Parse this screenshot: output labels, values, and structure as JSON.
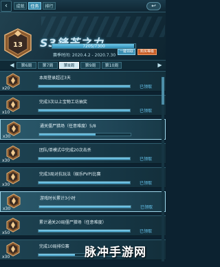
{
  "topbar": {
    "back_icon": "back-arrow-icon",
    "tabs": [
      {
        "label": "成就",
        "active": false
      },
      {
        "label": "任务",
        "active": true
      },
      {
        "label": "排行",
        "active": false
      }
    ],
    "close_icon": "close-icon",
    "close_glyph": "↩"
  },
  "season": {
    "title": "S3锋芒之力",
    "progress_text": "7205/7300",
    "progress_ratio": 0.987,
    "time_label": "赛季时间: 2020.4.2 - 2020.7.30",
    "upgrade_label": "一键领取",
    "buy_label": "购买等级",
    "badge_level": "13"
  },
  "weeks": {
    "left_arrow": "◀",
    "right_arrow": "▶",
    "tabs": [
      {
        "label": "第6周",
        "active": false
      },
      {
        "label": "第7周",
        "active": false
      },
      {
        "label": "第8周",
        "active": true
      },
      {
        "label": "第9周",
        "active": false
      },
      {
        "label": "第10周",
        "active": false
      }
    ]
  },
  "tasks": [
    {
      "title": "本周登录超过3天",
      "count": "x20",
      "progress": 1.0,
      "status": "已领取",
      "highlight": false
    },
    {
      "title": "完成3次以上宝物工坊抽奖",
      "count": "x10",
      "progress": 1.0,
      "status": "已领取",
      "highlight": false
    },
    {
      "title": "通关僵尸猎场（任意难度）5/8",
      "count": "x30",
      "progress": 0.62,
      "status": "",
      "highlight": true
    },
    {
      "title": "团队/单模式中完成20次击杀",
      "count": "x30",
      "progress": 1.0,
      "status": "已领取",
      "highlight": false
    },
    {
      "title": "完成3局对抗玩法（娱乐PVP)比赛",
      "count": "x30",
      "progress": 1.0,
      "status": "已领取",
      "highlight": false
    },
    {
      "title": "游戏时长累计3小时",
      "count": "x30",
      "progress": 1.0,
      "status": "已领取",
      "highlight": true
    },
    {
      "title": "累计通关20局僵尸猎场（任意难度）",
      "count": "x50",
      "progress": 1.0,
      "status": "已领取",
      "highlight": false
    },
    {
      "title": "完成10局排位赛",
      "count": "x30",
      "progress": 0.4,
      "status": "",
      "highlight": false
    }
  ],
  "watermark": "脉冲手游网",
  "colors": {
    "accent": "#3c8fb0",
    "status": "#67c7f0",
    "buy": "#c9602a"
  }
}
